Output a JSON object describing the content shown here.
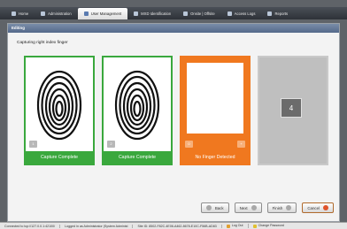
{
  "nav": {
    "items": [
      {
        "label": "Home",
        "icon": "home-icon",
        "active": false
      },
      {
        "label": "Administration",
        "icon": "admin-icon",
        "active": false
      },
      {
        "label": "User Management",
        "icon": "users-icon",
        "active": true
      },
      {
        "label": "MXD Identification",
        "icon": "identification-icon",
        "active": false
      },
      {
        "label": "Onsite | Offsite",
        "icon": "building-icon",
        "active": false
      },
      {
        "label": "Access Logs",
        "icon": "logs-icon",
        "active": false
      },
      {
        "label": "Reports",
        "icon": "reports-icon",
        "active": false
      }
    ]
  },
  "panel": {
    "title": "Editing",
    "instruction": "Capturing right index finger"
  },
  "slots": [
    {
      "status": "Capture Complete",
      "color": "#3aa83d",
      "index": "1"
    },
    {
      "status": "Capture Complete",
      "color": "#3aa83d",
      "index": "2"
    },
    {
      "status": "No Finger Detected",
      "color": "#f0781f",
      "index": "0"
    },
    {
      "status": "",
      "color": "#bfbfbf",
      "index": "4"
    }
  ],
  "buttons": {
    "back": "Back",
    "next": "Next",
    "finish": "Finish",
    "cancel": "Cancel"
  },
  "status": {
    "connection": "Connected to tcp://127.0.0.1:42100/",
    "user": "Logged in as Administrator (System Administ",
    "site": "Site ID: 8502-F82C-4E06-A462-8678-E10C-F56B-AD83",
    "logout": "Log Out",
    "change_password": "Change Password"
  }
}
